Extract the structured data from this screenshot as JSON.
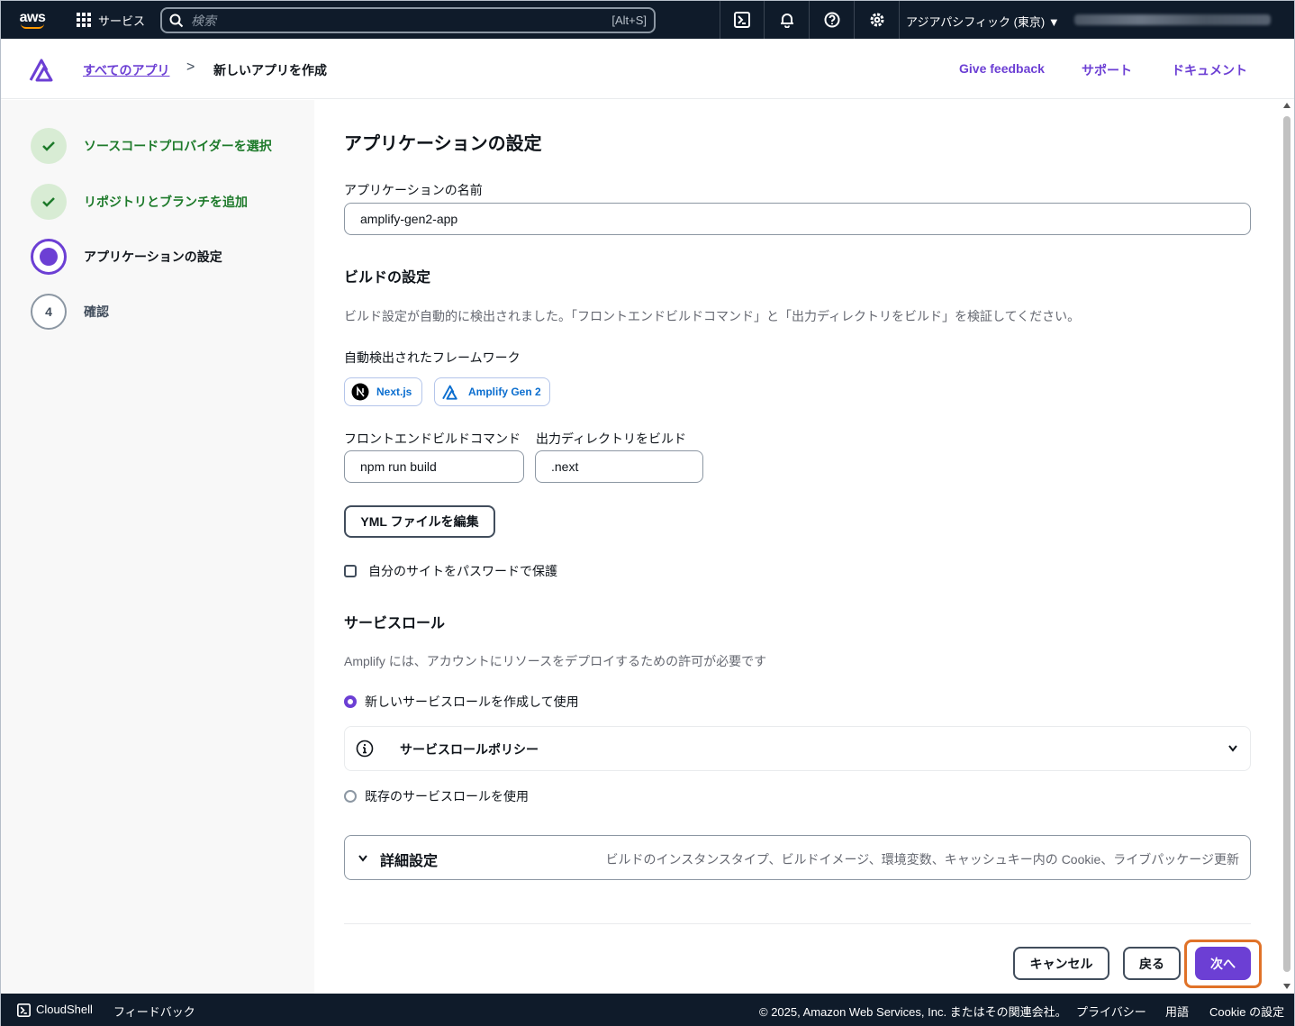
{
  "topnav": {
    "logo_text": "aws",
    "services_label": "サービス",
    "search_placeholder": "検索",
    "search_shortcut": "[Alt+S]",
    "icons": [
      "cloudshell-icon",
      "bell-icon",
      "help-icon",
      "settings-icon"
    ],
    "region": "アジアパシフィック (東京) ▼"
  },
  "header": {
    "breadcrumb_all": "すべてのアプリ",
    "breadcrumb_sep": ">",
    "breadcrumb_current": "新しいアプリを作成",
    "links": [
      "Give feedback",
      "サポート",
      "ドキュメント"
    ]
  },
  "steps": [
    {
      "label": "ソースコードプロバイダーを選択",
      "state": "done"
    },
    {
      "label": "リポジトリとブランチを追加",
      "state": "done"
    },
    {
      "label": "アプリケーションの設定",
      "state": "active"
    },
    {
      "number": "4",
      "label": "確認",
      "state": "todo"
    }
  ],
  "main": {
    "title": "アプリケーションの設定",
    "app_name_label": "アプリケーションの名前",
    "app_name_value": "amplify-gen2-app",
    "build_title": "ビルドの設定",
    "build_desc": "ビルド設定が自動的に検出されました。「フロントエンドビルドコマンド」と「出力ディレクトリをビルド」を検証してください。",
    "framework_label": "自動検出されたフレームワーク",
    "frameworks": [
      "Next.js",
      "Amplify Gen 2"
    ],
    "build_cmd_label": "フロントエンドビルドコマンド",
    "build_cmd_value": "npm run build",
    "output_dir_label": "出力ディレクトリをビルド",
    "output_dir_value": ".next",
    "edit_yml_button": "YML ファイルを編集",
    "password_checkbox": "自分のサイトをパスワードで保護",
    "role_title": "サービスロール",
    "role_desc": "Amplify には、アカウントにリソースをデプロイするための許可が必要です",
    "role_new": "新しいサービスロールを作成して使用",
    "policy_title": "サービスロールポリシー",
    "role_existing": "既存のサービスロールを使用",
    "advanced_title": "詳細設定",
    "advanced_desc": "ビルドのインスタンスタイプ、ビルドイメージ、環境変数、キャッシュキー内の Cookie、ライブパッケージ更新",
    "cancel_button": "キャンセル",
    "back_button": "戻る",
    "next_button": "次へ"
  },
  "footer": {
    "cloudshell": "CloudShell",
    "feedback": "フィードバック",
    "copyright": "© 2025, Amazon Web Services, Inc. またはその関連会社。",
    "privacy": "プライバシー",
    "terms": "用語",
    "cookie": "Cookie の設定"
  },
  "colors": {
    "accent": "#6c3fd4",
    "nav_bg": "#0f1b2a",
    "success": "#1d7a2a",
    "highlight": "#e07228"
  }
}
